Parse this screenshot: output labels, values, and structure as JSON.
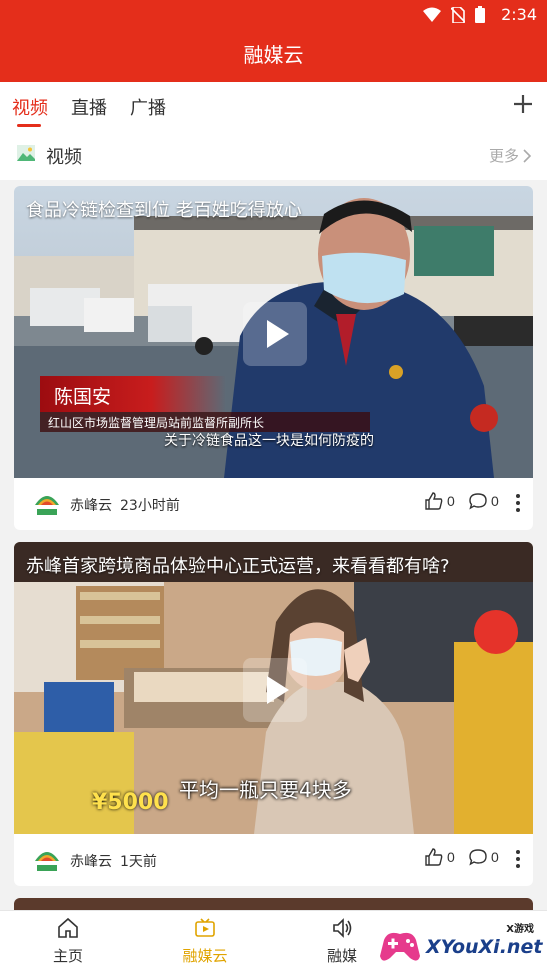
{
  "status_bar": {
    "time": "2:34"
  },
  "app_bar": {
    "title": "融媒云"
  },
  "tabs": [
    {
      "label": "视频",
      "active": true
    },
    {
      "label": "直播",
      "active": false
    },
    {
      "label": "广播",
      "active": false
    }
  ],
  "section": {
    "title": "视频",
    "more_label": "更多"
  },
  "cards": [
    {
      "title": "食品冷链检查到位  老百姓吃得放心",
      "overlay_name": "陈国安",
      "overlay_role": "红山区市场监督管理局站前监督所副所长",
      "overlay_subtitle": "关于冷链食品这一块是如何防疫的",
      "source": "赤峰云",
      "time": "23小时前",
      "likes": "0",
      "comments": "0"
    },
    {
      "title": "赤峰首家跨境商品体验中心正式运营，来看看都有啥?",
      "overlay_subtitle": "平均一瓶只要4块多",
      "overlay_price": "¥5000",
      "source": "赤峰云",
      "time": "1天前",
      "likes": "0",
      "comments": "0"
    }
  ],
  "bottom_nav": [
    {
      "label": "主页",
      "icon": "home-icon",
      "active": false
    },
    {
      "label": "融媒云",
      "icon": "video-icon",
      "active": true
    },
    {
      "label": "融媒",
      "icon": "speaker-icon",
      "active": false
    }
  ],
  "watermark": {
    "text": "XYouXi.net",
    "small": "X游戏"
  },
  "colors": {
    "brand_red": "#e42e1b",
    "active_nav": "#e0a400"
  }
}
